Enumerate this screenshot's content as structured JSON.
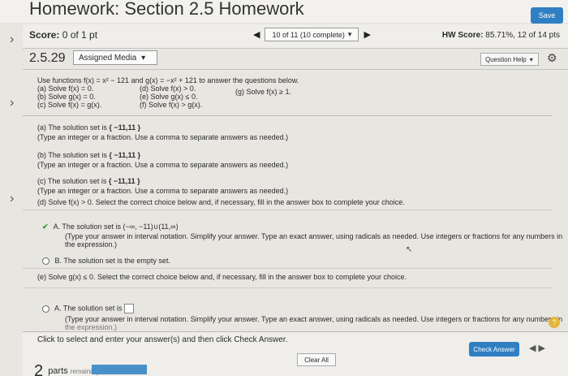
{
  "header": {
    "title": "Homework: Section 2.5 Homework",
    "save_label": "Save"
  },
  "score_bar": {
    "score_label": "Score:",
    "score_value": "0 of 1 pt",
    "question_nav": "10 of 11 (10 complete)",
    "hw_label": "HW Score:",
    "hw_value": "85.71%, 12 of 14 pts"
  },
  "question": {
    "number": "2.5.29",
    "media_label": "Assigned Media",
    "help_label": "Question Help"
  },
  "problem": {
    "intro": "Use functions f(x) = x² − 121 and g(x) = −x² + 121 to answer the questions below.",
    "a": "(a) Solve f(x) = 0.",
    "b": "(b) Solve g(x) = 0.",
    "c": "(c) Solve f(x) = g(x).",
    "d": "(d) Solve f(x) > 0.",
    "e": "(e) Solve g(x) ≤ 0.",
    "f": "(f) Solve f(x) > g(x).",
    "g": "(g) Solve f(x) ≥ 1."
  },
  "answers": {
    "a_label": "(a) The solution set is",
    "a_value": "{ −11,11 }",
    "a_hint": "(Type an integer or a fraction. Use a comma to separate answers as needed.)",
    "b_label": "(b) The solution set is",
    "b_value": "{ −11,11 }",
    "b_hint": "(Type an integer or a fraction. Use a comma to separate answers as needed.)",
    "c_label": "(c) The solution set is",
    "c_value": "{ −11,11 }",
    "c_hint": "(Type an integer or a fraction. Use a comma to separate answers as needed.)",
    "d_prompt": "(d) Solve f(x) > 0. Select the correct choice below and, if necessary, fill in the answer box to complete your choice.",
    "d_optA_letter": "A.",
    "d_optA_text": "The solution set is",
    "d_optA_value": "(−∞, −11)∪(11,∞)",
    "d_optA_hint1": "(Type your answer in interval notation. Simplify your answer. Type an exact answer, using radicals as needed. Use integers or fractions for any numbers in",
    "d_optA_hint2": "the expression.)",
    "d_optB_letter": "B.",
    "d_optB_text": "The solution set is the empty set.",
    "e_prompt": "(e) Solve g(x) ≤ 0. Select the correct choice below and, if necessary, fill in the answer box to complete your choice.",
    "e_optA_letter": "A.",
    "e_optA_text": "The solution set is",
    "e_optA_hint1": "(Type your answer in interval notation. Simplify your answer. Type an exact answer, using radicals as needed. Use integers or fractions for any numbers in",
    "e_optA_hint2": "the expression.)"
  },
  "footer": {
    "instruction": "Click to select and enter your answer(s) and then click Check Answer.",
    "clear_label": "Clear All",
    "check_label": "Check Answer",
    "parts_count": "2",
    "parts_label": "parts",
    "remaining_label": "remaining"
  },
  "colors": {
    "accent": "#2f7fc2",
    "check": "#2f9f3f"
  }
}
